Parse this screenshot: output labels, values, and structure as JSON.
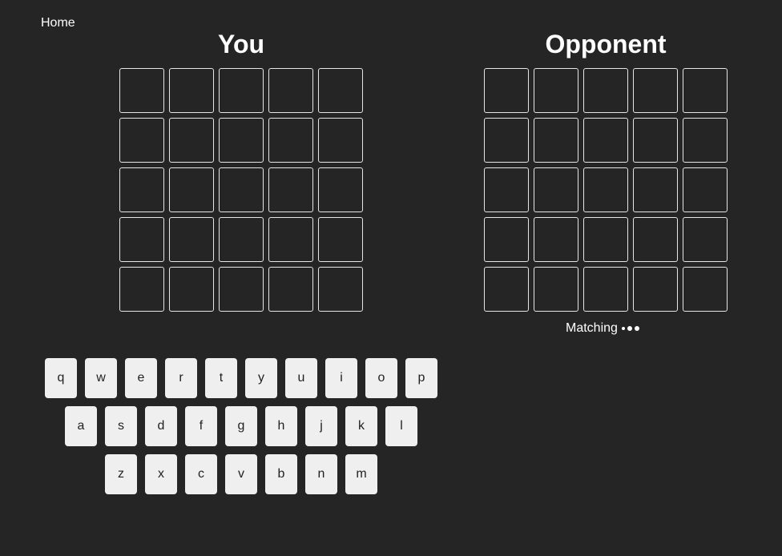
{
  "nav": {
    "home_label": "Home"
  },
  "boards": {
    "you": {
      "title": "You",
      "rows": 5,
      "cols": 5
    },
    "opponent": {
      "title": "Opponent",
      "rows": 5,
      "cols": 5
    }
  },
  "status": {
    "text": "Matching"
  },
  "keyboard": {
    "rows": [
      [
        "q",
        "w",
        "e",
        "r",
        "t",
        "y",
        "u",
        "i",
        "o",
        "p"
      ],
      [
        "a",
        "s",
        "d",
        "f",
        "g",
        "h",
        "j",
        "k",
        "l"
      ],
      [
        "z",
        "x",
        "c",
        "v",
        "b",
        "n",
        "m"
      ]
    ]
  },
  "colors": {
    "background": "#252525",
    "tile_border": "#e6e6e6",
    "key_background": "#efefef",
    "key_text": "#222222",
    "text": "#ffffff"
  }
}
